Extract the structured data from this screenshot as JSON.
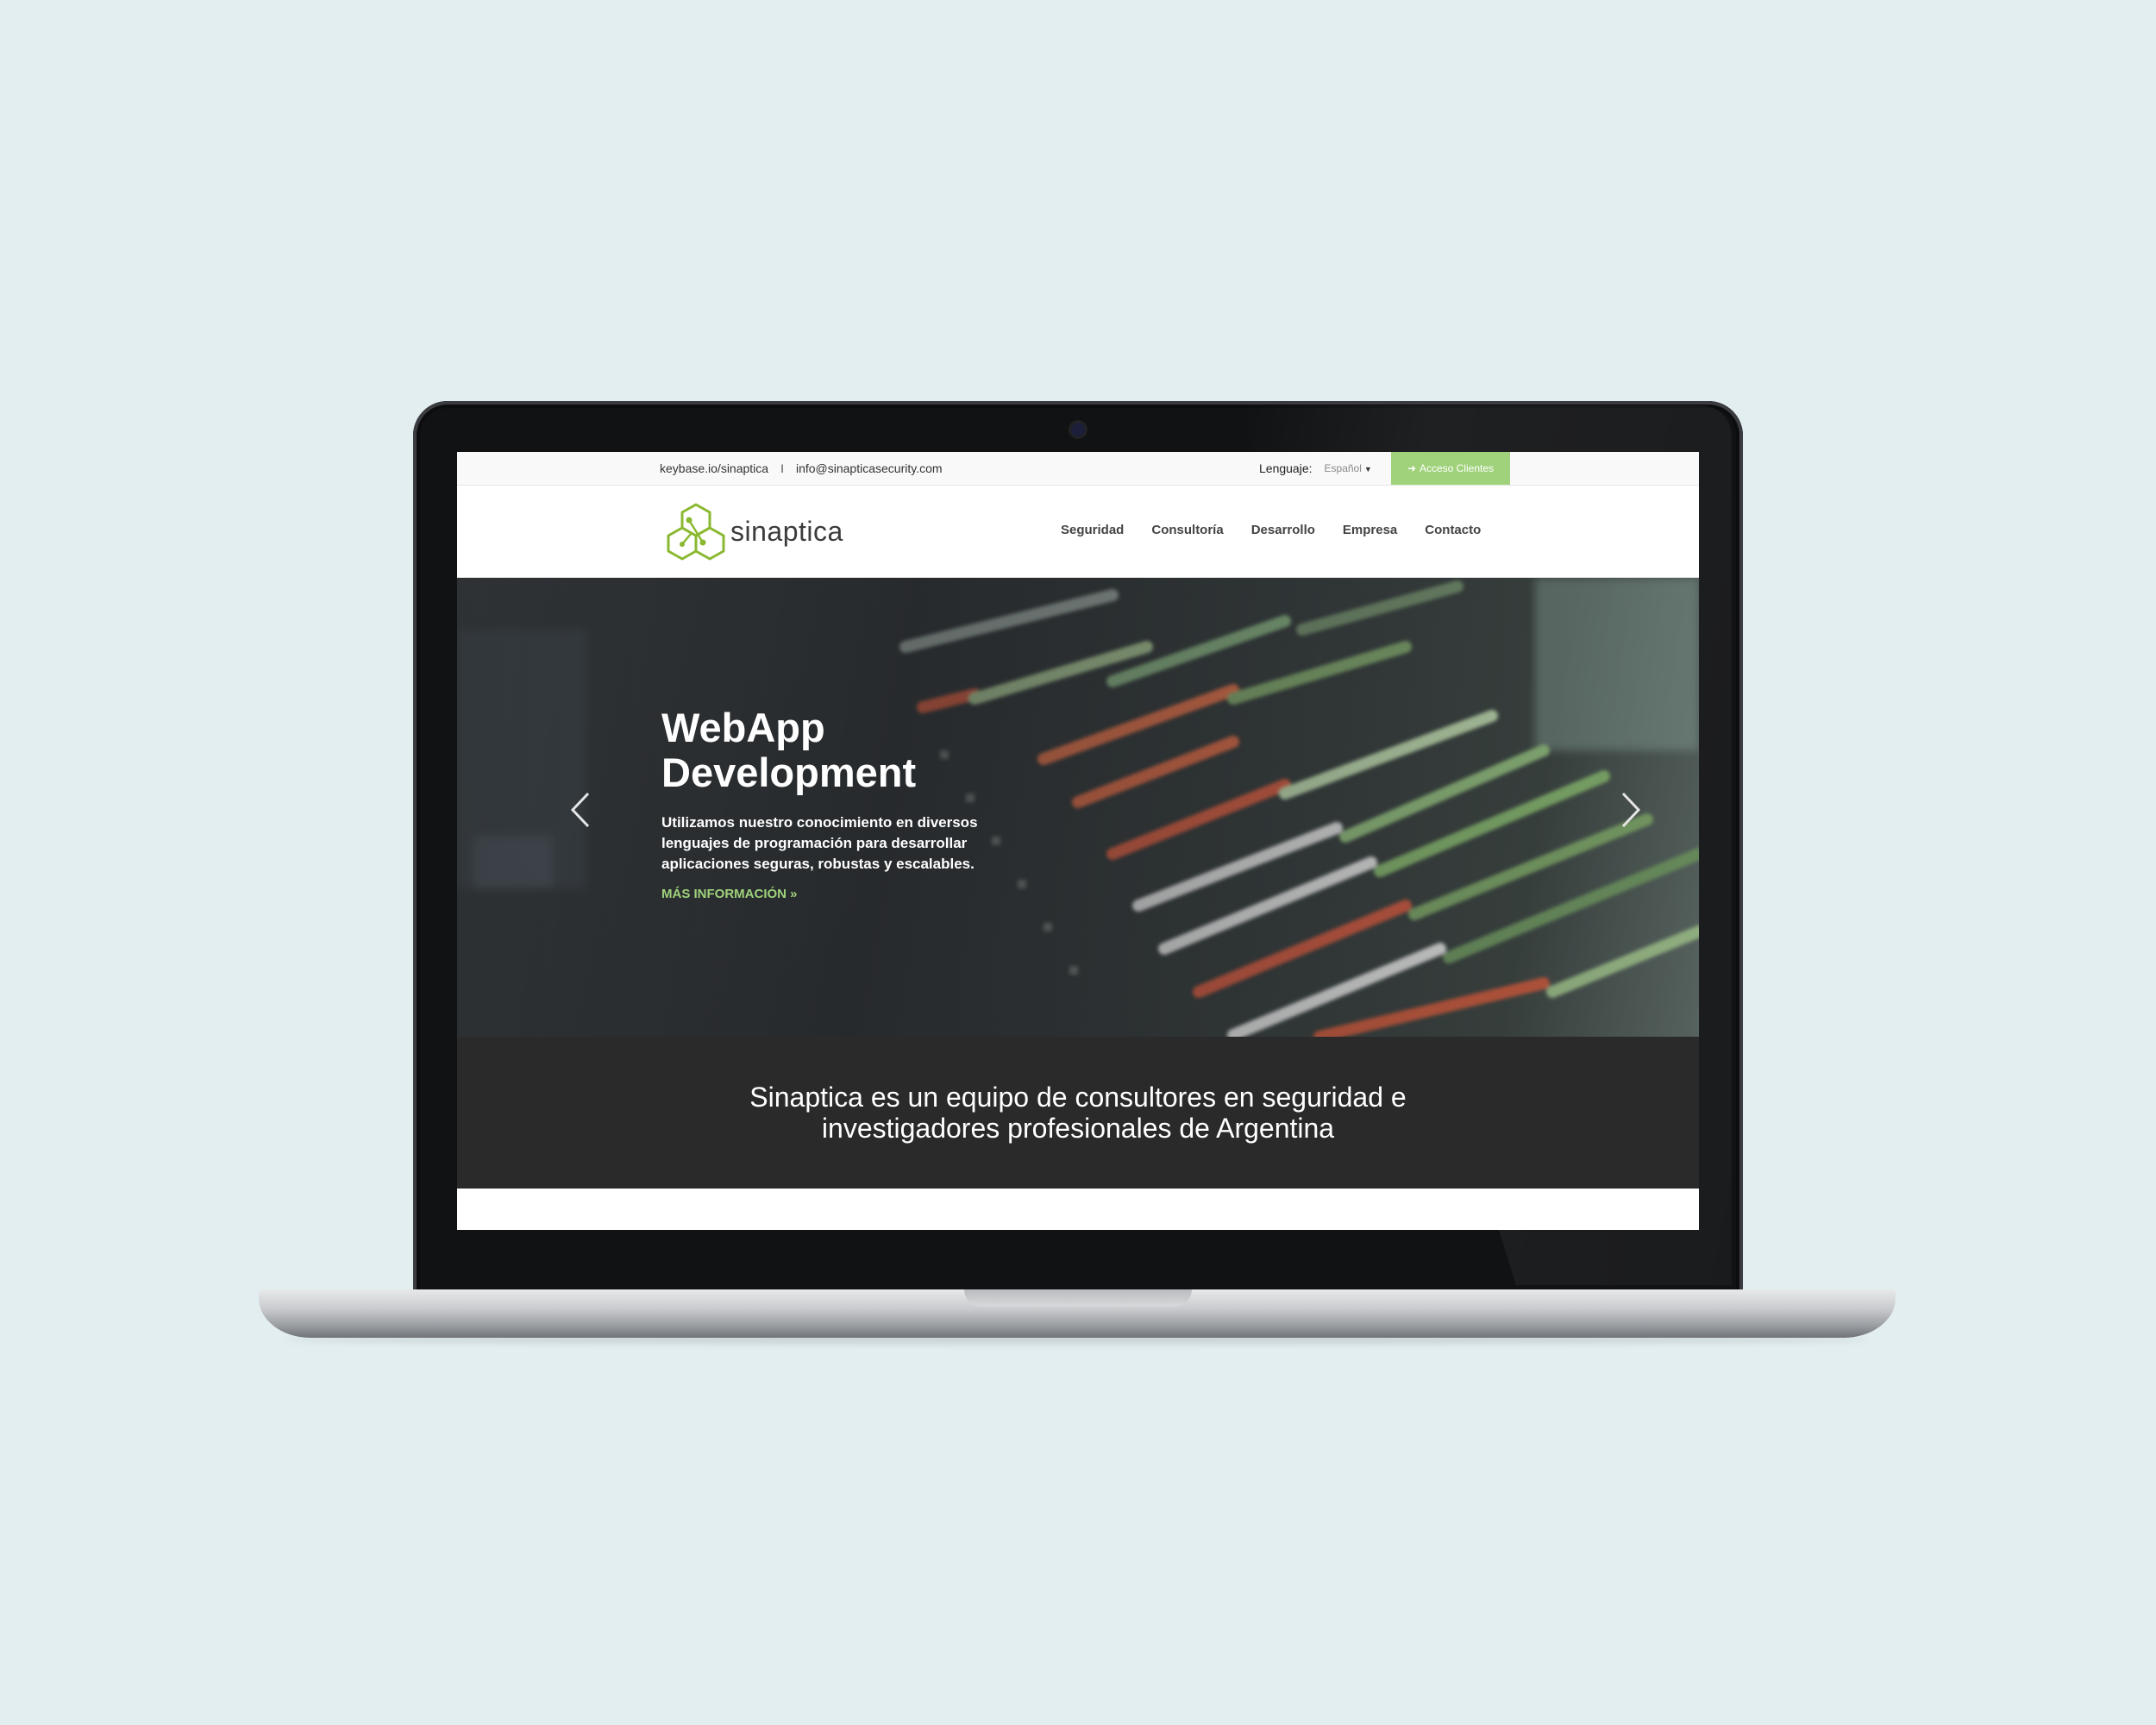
{
  "topbar": {
    "keybase": "keybase.io/sinaptica",
    "separator": "I",
    "email": "info@sinapticasecurity.com",
    "language_label": "Lenguaje:",
    "language_value": "Español",
    "client_access": "Acceso Clientes",
    "client_icon": "sign-in-icon"
  },
  "brand": {
    "name": "sinaptica",
    "accent": "#9fd27b",
    "logo_color": "#8ab830"
  },
  "nav": {
    "items": [
      "Seguridad",
      "Consultoría",
      "Desarrollo",
      "Empresa",
      "Contacto"
    ]
  },
  "hero": {
    "title_line1": "WebApp",
    "title_line2": "Development",
    "text": "Utilizamos nuestro conocimiento en diversos lenguajes de programación para desarrollar aplicaciones seguras, robustas y escalables.",
    "link": "MÁS INFORMACIÓN »",
    "prev_icon": "chevron-left-icon",
    "next_icon": "chevron-right-icon"
  },
  "mission": {
    "brand": "Sinaptica",
    "line1_rest": " es un equipo de consultores en seguridad e",
    "line2": "investigadores profesionales de Argentina"
  }
}
